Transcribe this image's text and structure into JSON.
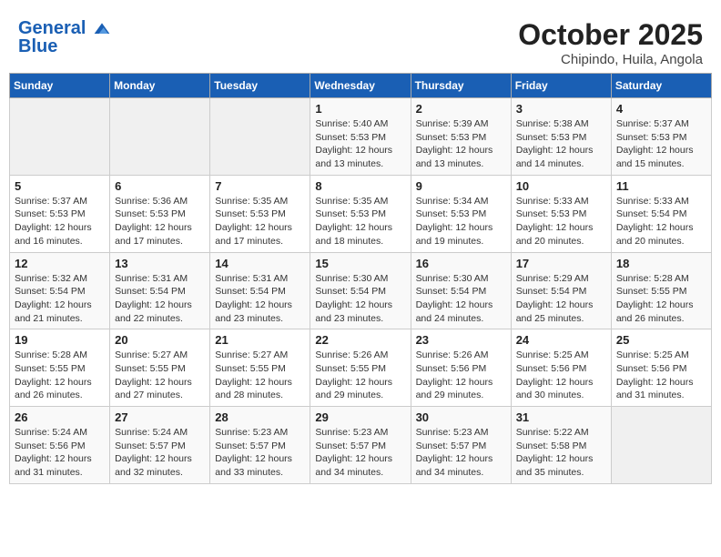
{
  "header": {
    "logo_line1": "General",
    "logo_line2": "Blue",
    "month": "October 2025",
    "location": "Chipindo, Huila, Angola"
  },
  "weekdays": [
    "Sunday",
    "Monday",
    "Tuesday",
    "Wednesday",
    "Thursday",
    "Friday",
    "Saturday"
  ],
  "weeks": [
    [
      {
        "day": "",
        "info": ""
      },
      {
        "day": "",
        "info": ""
      },
      {
        "day": "",
        "info": ""
      },
      {
        "day": "1",
        "info": "Sunrise: 5:40 AM\nSunset: 5:53 PM\nDaylight: 12 hours\nand 13 minutes."
      },
      {
        "day": "2",
        "info": "Sunrise: 5:39 AM\nSunset: 5:53 PM\nDaylight: 12 hours\nand 13 minutes."
      },
      {
        "day": "3",
        "info": "Sunrise: 5:38 AM\nSunset: 5:53 PM\nDaylight: 12 hours\nand 14 minutes."
      },
      {
        "day": "4",
        "info": "Sunrise: 5:37 AM\nSunset: 5:53 PM\nDaylight: 12 hours\nand 15 minutes."
      }
    ],
    [
      {
        "day": "5",
        "info": "Sunrise: 5:37 AM\nSunset: 5:53 PM\nDaylight: 12 hours\nand 16 minutes."
      },
      {
        "day": "6",
        "info": "Sunrise: 5:36 AM\nSunset: 5:53 PM\nDaylight: 12 hours\nand 17 minutes."
      },
      {
        "day": "7",
        "info": "Sunrise: 5:35 AM\nSunset: 5:53 PM\nDaylight: 12 hours\nand 17 minutes."
      },
      {
        "day": "8",
        "info": "Sunrise: 5:35 AM\nSunset: 5:53 PM\nDaylight: 12 hours\nand 18 minutes."
      },
      {
        "day": "9",
        "info": "Sunrise: 5:34 AM\nSunset: 5:53 PM\nDaylight: 12 hours\nand 19 minutes."
      },
      {
        "day": "10",
        "info": "Sunrise: 5:33 AM\nSunset: 5:53 PM\nDaylight: 12 hours\nand 20 minutes."
      },
      {
        "day": "11",
        "info": "Sunrise: 5:33 AM\nSunset: 5:54 PM\nDaylight: 12 hours\nand 20 minutes."
      }
    ],
    [
      {
        "day": "12",
        "info": "Sunrise: 5:32 AM\nSunset: 5:54 PM\nDaylight: 12 hours\nand 21 minutes."
      },
      {
        "day": "13",
        "info": "Sunrise: 5:31 AM\nSunset: 5:54 PM\nDaylight: 12 hours\nand 22 minutes."
      },
      {
        "day": "14",
        "info": "Sunrise: 5:31 AM\nSunset: 5:54 PM\nDaylight: 12 hours\nand 23 minutes."
      },
      {
        "day": "15",
        "info": "Sunrise: 5:30 AM\nSunset: 5:54 PM\nDaylight: 12 hours\nand 23 minutes."
      },
      {
        "day": "16",
        "info": "Sunrise: 5:30 AM\nSunset: 5:54 PM\nDaylight: 12 hours\nand 24 minutes."
      },
      {
        "day": "17",
        "info": "Sunrise: 5:29 AM\nSunset: 5:54 PM\nDaylight: 12 hours\nand 25 minutes."
      },
      {
        "day": "18",
        "info": "Sunrise: 5:28 AM\nSunset: 5:55 PM\nDaylight: 12 hours\nand 26 minutes."
      }
    ],
    [
      {
        "day": "19",
        "info": "Sunrise: 5:28 AM\nSunset: 5:55 PM\nDaylight: 12 hours\nand 26 minutes."
      },
      {
        "day": "20",
        "info": "Sunrise: 5:27 AM\nSunset: 5:55 PM\nDaylight: 12 hours\nand 27 minutes."
      },
      {
        "day": "21",
        "info": "Sunrise: 5:27 AM\nSunset: 5:55 PM\nDaylight: 12 hours\nand 28 minutes."
      },
      {
        "day": "22",
        "info": "Sunrise: 5:26 AM\nSunset: 5:55 PM\nDaylight: 12 hours\nand 29 minutes."
      },
      {
        "day": "23",
        "info": "Sunrise: 5:26 AM\nSunset: 5:56 PM\nDaylight: 12 hours\nand 29 minutes."
      },
      {
        "day": "24",
        "info": "Sunrise: 5:25 AM\nSunset: 5:56 PM\nDaylight: 12 hours\nand 30 minutes."
      },
      {
        "day": "25",
        "info": "Sunrise: 5:25 AM\nSunset: 5:56 PM\nDaylight: 12 hours\nand 31 minutes."
      }
    ],
    [
      {
        "day": "26",
        "info": "Sunrise: 5:24 AM\nSunset: 5:56 PM\nDaylight: 12 hours\nand 31 minutes."
      },
      {
        "day": "27",
        "info": "Sunrise: 5:24 AM\nSunset: 5:57 PM\nDaylight: 12 hours\nand 32 minutes."
      },
      {
        "day": "28",
        "info": "Sunrise: 5:23 AM\nSunset: 5:57 PM\nDaylight: 12 hours\nand 33 minutes."
      },
      {
        "day": "29",
        "info": "Sunrise: 5:23 AM\nSunset: 5:57 PM\nDaylight: 12 hours\nand 34 minutes."
      },
      {
        "day": "30",
        "info": "Sunrise: 5:23 AM\nSunset: 5:57 PM\nDaylight: 12 hours\nand 34 minutes."
      },
      {
        "day": "31",
        "info": "Sunrise: 5:22 AM\nSunset: 5:58 PM\nDaylight: 12 hours\nand 35 minutes."
      },
      {
        "day": "",
        "info": ""
      }
    ]
  ]
}
